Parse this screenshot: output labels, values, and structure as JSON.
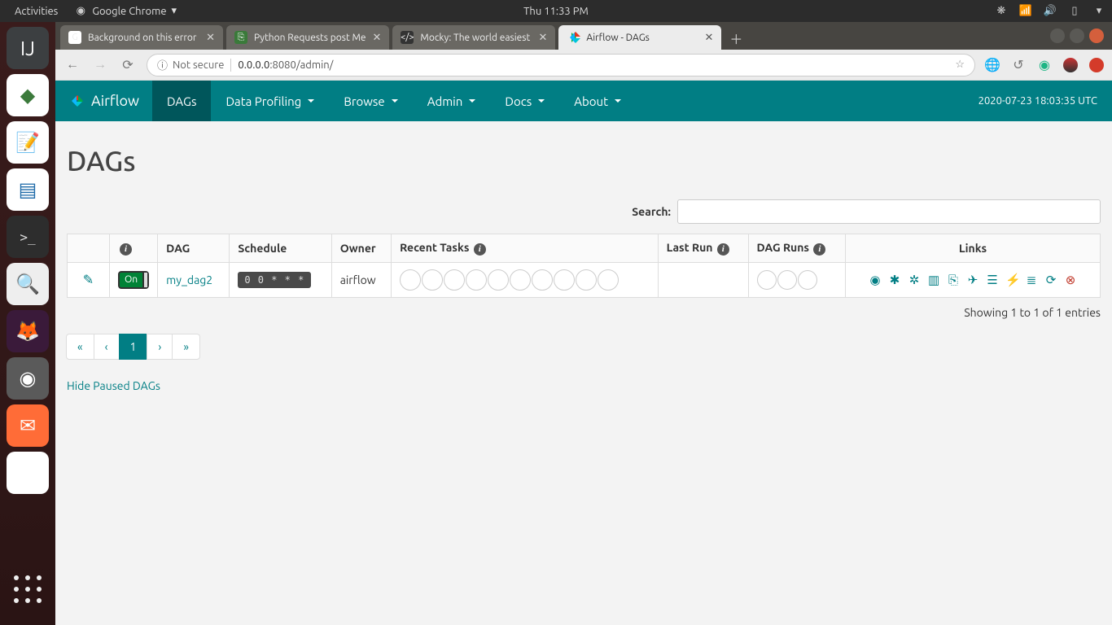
{
  "ubuntu": {
    "activities": "Activities",
    "app": "Google Chrome",
    "clock": "Thu 11:33 PM"
  },
  "tabs": [
    {
      "title": "Background on this error",
      "active": false
    },
    {
      "title": "Python Requests post Me",
      "active": false
    },
    {
      "title": "Mocky: The world easiest",
      "active": false
    },
    {
      "title": "Airflow - DAGs",
      "active": true
    }
  ],
  "addressbar": {
    "secure_label": "Not secure",
    "url_host": "0.0.0.0",
    "url_path": ":8080/admin/"
  },
  "airflow": {
    "brand": "Airflow",
    "nav": [
      "DAGs",
      "Data Profiling",
      "Browse",
      "Admin",
      "Docs",
      "About"
    ],
    "utc": "2020-07-23 18:03:35 UTC"
  },
  "page_title": "DAGs",
  "search_label": "Search:",
  "columns": {
    "dag": "DAG",
    "schedule": "Schedule",
    "owner": "Owner",
    "recent": "Recent Tasks",
    "lastrun": "Last Run",
    "dagruns": "DAG Runs",
    "links": "Links"
  },
  "row": {
    "toggle": "On",
    "dag": "my_dag2",
    "schedule": "0 0 * * *",
    "owner": "airflow"
  },
  "link_icons": [
    {
      "name": "trigger-dag-icon",
      "glyph": "◉"
    },
    {
      "name": "tree-view-icon",
      "glyph": "✱"
    },
    {
      "name": "graph-view-icon",
      "glyph": "✲"
    },
    {
      "name": "task-duration-icon",
      "glyph": "▥"
    },
    {
      "name": "task-tries-icon",
      "glyph": "⎘"
    },
    {
      "name": "landing-times-icon",
      "glyph": "✈"
    },
    {
      "name": "gantt-icon",
      "glyph": "☰"
    },
    {
      "name": "zap-icon",
      "glyph": "⚡"
    },
    {
      "name": "logs-icon",
      "glyph": "≣"
    },
    {
      "name": "refresh-icon",
      "glyph": "⟳"
    }
  ],
  "showing": "Showing 1 to 1 of 1 entries",
  "pager": [
    "«",
    "‹",
    "1",
    "›",
    "»"
  ],
  "hide_paused": "Hide Paused DAGs"
}
